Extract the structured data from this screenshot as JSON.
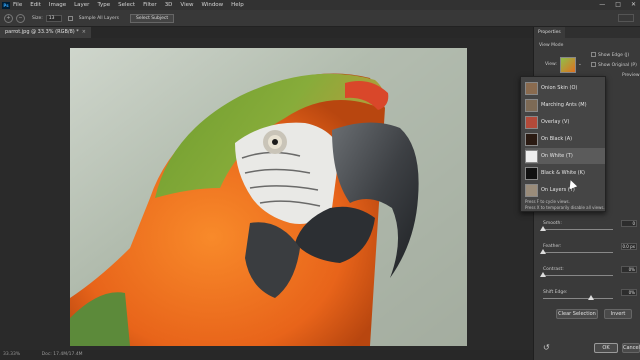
{
  "menubar": {
    "logo": "Ps",
    "items": [
      "File",
      "Edit",
      "Image",
      "Layer",
      "Type",
      "Select",
      "Filter",
      "3D",
      "View",
      "Window",
      "Help"
    ],
    "controls": [
      "—",
      "□",
      "✕"
    ]
  },
  "options": {
    "size_label": "Size:",
    "size_value": "13",
    "sample_all_layers": "Sample All Layers",
    "select_subject": "Select Subject"
  },
  "document": {
    "tab_title": "parrot.jpg @ 33.3% (RGB/8) *",
    "close": "×",
    "zoom": "33.33%",
    "doc_info": "Doc: 17.4M/17.4M"
  },
  "panel": {
    "tab_label": "Properties",
    "view_mode": "View Mode",
    "view_label": "View:",
    "show_edge": "Show Edge (J)",
    "show_original": "Show Original (P)",
    "preview": "Preview"
  },
  "dropdown": {
    "items": [
      {
        "label": "Onion Skin (O)",
        "color": "#8a6b4f"
      },
      {
        "label": "Marching Ants (M)",
        "color": "#7d6a55"
      },
      {
        "label": "Overlay (V)",
        "color": "#b34a3a"
      },
      {
        "label": "On Black (A)",
        "color": "#2a1a12"
      },
      {
        "label": "On White (T)",
        "color": "#eeeeee"
      },
      {
        "label": "Black & White (K)",
        "color": "#111111"
      },
      {
        "label": "On Layers (Y)",
        "color": "#9a8c7a"
      }
    ],
    "hint1": "Press F to cycle views.",
    "hint2": "Press X to temporarily disable all views."
  },
  "sliders": [
    {
      "label": "Smooth:",
      "value": "0",
      "level": 0.0
    },
    {
      "label": "Feather:",
      "value": "0.0 px",
      "level": 0.0
    },
    {
      "label": "Contrast:",
      "value": "0%",
      "level": 0.0
    },
    {
      "label": "Shift Edge:",
      "value": "0%",
      "level": 0.68
    }
  ],
  "buttons": {
    "clear_selection": "Clear Selection",
    "invert": "Invert",
    "ok": "OK",
    "cancel": "Cancel"
  }
}
